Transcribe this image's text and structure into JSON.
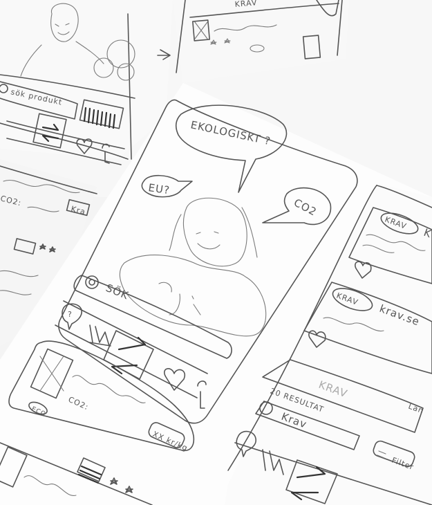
{
  "photo": {
    "subject": "Pencil sketches of mobile app screens on paper"
  },
  "back_sheet_left": {
    "search_label": "sök produkt",
    "co2_label": "CO2: ",
    "eco_label": "Kra"
  },
  "back_sheet_right": {
    "badge_label": "KRAV"
  },
  "main_sheet": {
    "bubble_ecologic": "EKOLOGISKT ?",
    "bubble_eu": "EU?",
    "bubble_co2": "CO2",
    "search_label": "SÖK",
    "card_co2_label": "CO2:",
    "card_badge": "XX kr/kg",
    "card_eco": "ECO",
    "nav_icons": [
      "help-icon",
      "stats-icon",
      "swap-icon",
      "heart-icon",
      "profile-icon"
    ]
  },
  "right_sheet": {
    "card1_badge": "KRAV",
    "card1_side": "K",
    "card2_badge": "KRAV",
    "card2_text": "krav.se",
    "search_value": "Krav",
    "results_label": "20 RESULTAT",
    "filter_label": "Filter",
    "faded_text": "KRAV",
    "side_text": "Län"
  }
}
